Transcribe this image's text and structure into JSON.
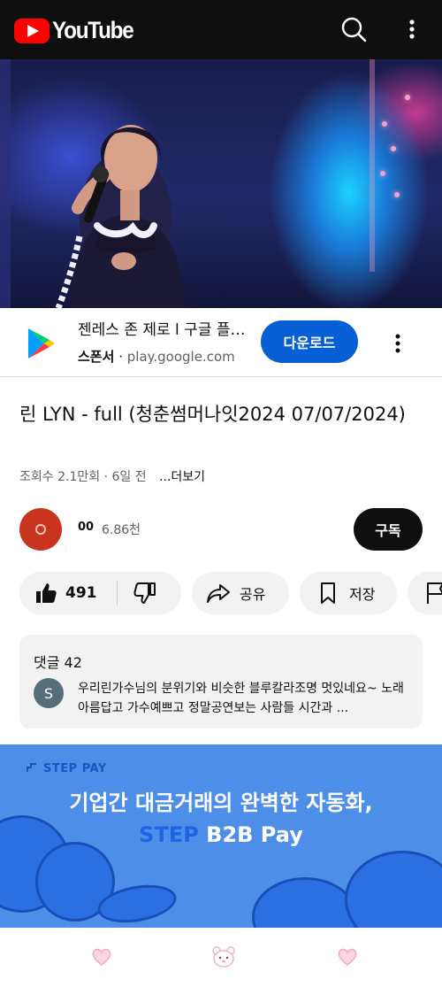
{
  "app": {
    "name": "YouTube",
    "brand_color": "#ff0000",
    "icons": [
      "search-icon",
      "more-vert-icon"
    ]
  },
  "ad": {
    "title": "젠레스 존 제로 l 구글 플레이",
    "sponsor_label": "스폰서",
    "separator": "·",
    "domain": "play.google.com",
    "cta_label": "다운로드",
    "cta_color": "#065fd4",
    "icon": "google-play-icon"
  },
  "video": {
    "title": "린 LYN - full (청춘썸머나잇2024 07/07/2024)",
    "views": "조회수 2.1만회",
    "age": "6일 전",
    "meta_separator": "·",
    "more_label": "...더보기"
  },
  "channel": {
    "name": "00",
    "subscribers": "6.86천",
    "subscribe_label": "구독"
  },
  "actions": {
    "like_count": "491",
    "share_label": "공유",
    "save_label": "저장"
  },
  "comments": {
    "header_label": "댓글",
    "count": "42",
    "top_comment": {
      "avatar_letter": "S",
      "text": "우리린가수님의 분위기와 비슷한 블루칼라조명 멋있네요~ 노래아름답고 가수예쁘고 정말공연보는 사람들 시간과 ..."
    }
  },
  "banner_ad": {
    "brand": "STEP PAY",
    "line1": "기업간 대금거래의 완벽한 자동화,",
    "line2_accent": "STEP",
    "line2_rest": " B2B Pay",
    "background": "#4d8ee8",
    "accent_color": "#1e64e6"
  },
  "bottom_nav": {
    "icons": [
      "heart-icon",
      "bear-icon",
      "heart-icon"
    ],
    "icon_color": "#f6a8c4"
  }
}
